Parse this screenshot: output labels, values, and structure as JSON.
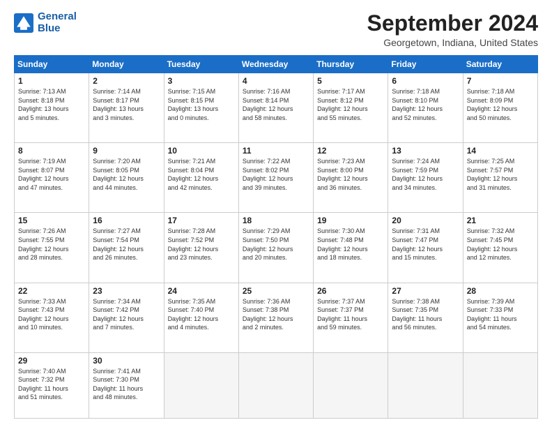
{
  "logo": {
    "line1": "General",
    "line2": "Blue"
  },
  "header": {
    "title": "September 2024",
    "location": "Georgetown, Indiana, United States"
  },
  "weekdays": [
    "Sunday",
    "Monday",
    "Tuesday",
    "Wednesday",
    "Thursday",
    "Friday",
    "Saturday"
  ],
  "weeks": [
    [
      {
        "day": "1",
        "info": "Sunrise: 7:13 AM\nSunset: 8:18 PM\nDaylight: 13 hours\nand 5 minutes."
      },
      {
        "day": "2",
        "info": "Sunrise: 7:14 AM\nSunset: 8:17 PM\nDaylight: 13 hours\nand 3 minutes."
      },
      {
        "day": "3",
        "info": "Sunrise: 7:15 AM\nSunset: 8:15 PM\nDaylight: 13 hours\nand 0 minutes."
      },
      {
        "day": "4",
        "info": "Sunrise: 7:16 AM\nSunset: 8:14 PM\nDaylight: 12 hours\nand 58 minutes."
      },
      {
        "day": "5",
        "info": "Sunrise: 7:17 AM\nSunset: 8:12 PM\nDaylight: 12 hours\nand 55 minutes."
      },
      {
        "day": "6",
        "info": "Sunrise: 7:18 AM\nSunset: 8:10 PM\nDaylight: 12 hours\nand 52 minutes."
      },
      {
        "day": "7",
        "info": "Sunrise: 7:18 AM\nSunset: 8:09 PM\nDaylight: 12 hours\nand 50 minutes."
      }
    ],
    [
      {
        "day": "8",
        "info": "Sunrise: 7:19 AM\nSunset: 8:07 PM\nDaylight: 12 hours\nand 47 minutes."
      },
      {
        "day": "9",
        "info": "Sunrise: 7:20 AM\nSunset: 8:05 PM\nDaylight: 12 hours\nand 44 minutes."
      },
      {
        "day": "10",
        "info": "Sunrise: 7:21 AM\nSunset: 8:04 PM\nDaylight: 12 hours\nand 42 minutes."
      },
      {
        "day": "11",
        "info": "Sunrise: 7:22 AM\nSunset: 8:02 PM\nDaylight: 12 hours\nand 39 minutes."
      },
      {
        "day": "12",
        "info": "Sunrise: 7:23 AM\nSunset: 8:00 PM\nDaylight: 12 hours\nand 36 minutes."
      },
      {
        "day": "13",
        "info": "Sunrise: 7:24 AM\nSunset: 7:59 PM\nDaylight: 12 hours\nand 34 minutes."
      },
      {
        "day": "14",
        "info": "Sunrise: 7:25 AM\nSunset: 7:57 PM\nDaylight: 12 hours\nand 31 minutes."
      }
    ],
    [
      {
        "day": "15",
        "info": "Sunrise: 7:26 AM\nSunset: 7:55 PM\nDaylight: 12 hours\nand 28 minutes."
      },
      {
        "day": "16",
        "info": "Sunrise: 7:27 AM\nSunset: 7:54 PM\nDaylight: 12 hours\nand 26 minutes."
      },
      {
        "day": "17",
        "info": "Sunrise: 7:28 AM\nSunset: 7:52 PM\nDaylight: 12 hours\nand 23 minutes."
      },
      {
        "day": "18",
        "info": "Sunrise: 7:29 AM\nSunset: 7:50 PM\nDaylight: 12 hours\nand 20 minutes."
      },
      {
        "day": "19",
        "info": "Sunrise: 7:30 AM\nSunset: 7:48 PM\nDaylight: 12 hours\nand 18 minutes."
      },
      {
        "day": "20",
        "info": "Sunrise: 7:31 AM\nSunset: 7:47 PM\nDaylight: 12 hours\nand 15 minutes."
      },
      {
        "day": "21",
        "info": "Sunrise: 7:32 AM\nSunset: 7:45 PM\nDaylight: 12 hours\nand 12 minutes."
      }
    ],
    [
      {
        "day": "22",
        "info": "Sunrise: 7:33 AM\nSunset: 7:43 PM\nDaylight: 12 hours\nand 10 minutes."
      },
      {
        "day": "23",
        "info": "Sunrise: 7:34 AM\nSunset: 7:42 PM\nDaylight: 12 hours\nand 7 minutes."
      },
      {
        "day": "24",
        "info": "Sunrise: 7:35 AM\nSunset: 7:40 PM\nDaylight: 12 hours\nand 4 minutes."
      },
      {
        "day": "25",
        "info": "Sunrise: 7:36 AM\nSunset: 7:38 PM\nDaylight: 12 hours\nand 2 minutes."
      },
      {
        "day": "26",
        "info": "Sunrise: 7:37 AM\nSunset: 7:37 PM\nDaylight: 11 hours\nand 59 minutes."
      },
      {
        "day": "27",
        "info": "Sunrise: 7:38 AM\nSunset: 7:35 PM\nDaylight: 11 hours\nand 56 minutes."
      },
      {
        "day": "28",
        "info": "Sunrise: 7:39 AM\nSunset: 7:33 PM\nDaylight: 11 hours\nand 54 minutes."
      }
    ],
    [
      {
        "day": "29",
        "info": "Sunrise: 7:40 AM\nSunset: 7:32 PM\nDaylight: 11 hours\nand 51 minutes."
      },
      {
        "day": "30",
        "info": "Sunrise: 7:41 AM\nSunset: 7:30 PM\nDaylight: 11 hours\nand 48 minutes."
      },
      {
        "day": "",
        "info": ""
      },
      {
        "day": "",
        "info": ""
      },
      {
        "day": "",
        "info": ""
      },
      {
        "day": "",
        "info": ""
      },
      {
        "day": "",
        "info": ""
      }
    ]
  ]
}
